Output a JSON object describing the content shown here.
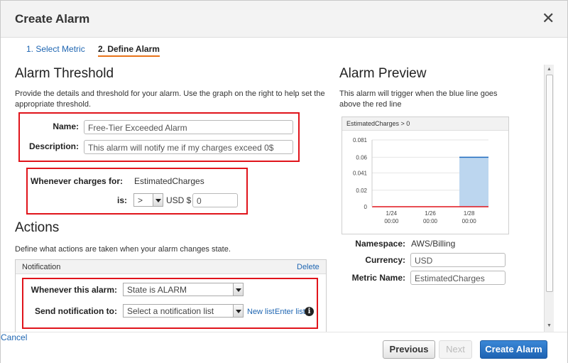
{
  "dialog": {
    "title": "Create Alarm",
    "close_glyph": "✕"
  },
  "wizard": {
    "steps": [
      {
        "label": "1. Select Metric"
      },
      {
        "label": "2. Define Alarm"
      }
    ]
  },
  "threshold": {
    "heading": "Alarm Threshold",
    "description": "Provide the details and threshold for your alarm. Use the graph on the right to help set the appropriate threshold.",
    "name_label": "Name:",
    "name_value": "Free-Tier Exceeded Alarm",
    "description_label": "Description:",
    "description_value": "This alarm will notify me if my charges exceed 0$",
    "charges_label": "Whenever charges for:",
    "charges_value": "EstimatedCharges",
    "is_label": "is:",
    "operator": ">",
    "currency_unit": "USD $",
    "amount": "0"
  },
  "actions": {
    "heading": "Actions",
    "description": "Define what actions are taken when your alarm changes state.",
    "panel_title": "Notification",
    "delete_label": "Delete",
    "state_label": "Whenever this alarm:",
    "state_value": "State is ALARM",
    "send_label": "Send notification to:",
    "send_value": "Select a notification list",
    "new_list": "New list",
    "enter_list": "Enter list",
    "info_glyph": "i"
  },
  "preview": {
    "heading": "Alarm Preview",
    "description": "This alarm will trigger when the blue line goes above the red line",
    "namespace_label": "Namespace:",
    "namespace_value": "AWS/Billing",
    "currency_label": "Currency:",
    "currency_value": "USD",
    "metric_label": "Metric Name:",
    "metric_value": "EstimatedCharges"
  },
  "chart_data": {
    "type": "area",
    "title": "EstimatedCharges > 0",
    "y_ticks": [
      "0.081",
      "0.06",
      "0.041",
      "0.02",
      "0"
    ],
    "ylim": [
      0,
      0.081
    ],
    "x_ticks": [
      {
        "label": "1/24",
        "sub": "00:00"
      },
      {
        "label": "1/26",
        "sub": "00:00"
      },
      {
        "label": "1/28",
        "sub": "00:00"
      }
    ],
    "series": [
      {
        "start": "1/27 12:00",
        "end": "1/29 12:00",
        "value": 0.06,
        "color": "#1f6bbf",
        "fill": "#bcd6ef"
      }
    ],
    "threshold": {
      "value": 0,
      "color": "#e0141b"
    }
  },
  "footer": {
    "cancel_label": "Cancel",
    "previous_label": "Previous",
    "next_label": "Next",
    "create_label": "Create Alarm"
  },
  "colors": {
    "highlight": "#e0141b",
    "link": "#1f66b2",
    "primary": "#1e63b3",
    "step_underline": "#e8731a"
  }
}
